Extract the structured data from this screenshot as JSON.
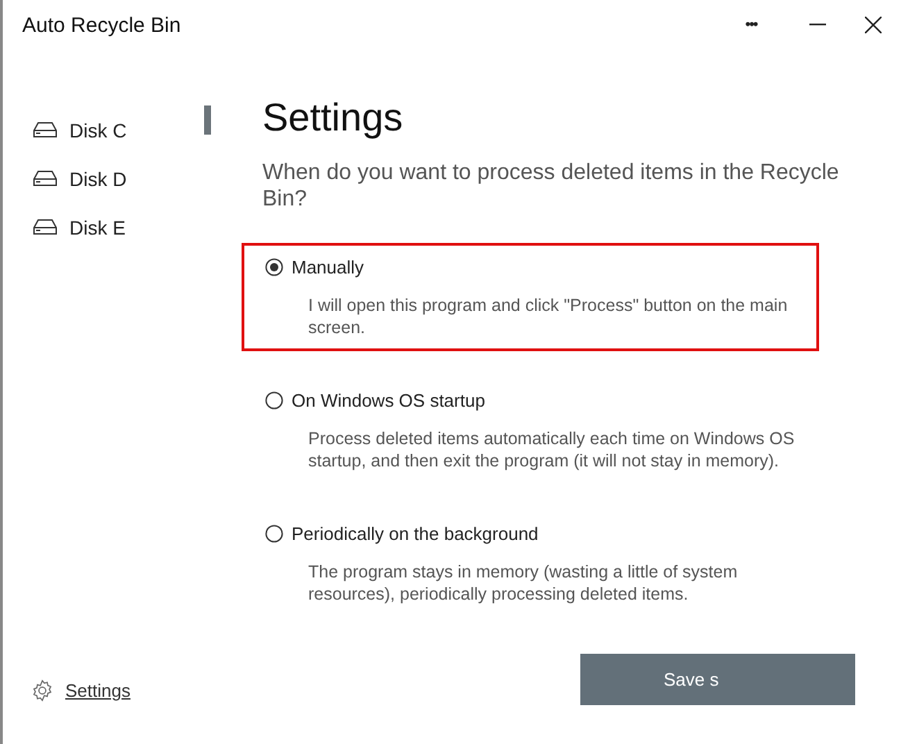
{
  "window": {
    "title": "Auto Recycle Bin",
    "menu_glyph": "•••"
  },
  "sidebar": {
    "items": [
      {
        "label": "Disk C",
        "selected": false
      },
      {
        "label": "Disk D",
        "selected": false
      },
      {
        "label": "Disk E",
        "selected": false
      }
    ],
    "footer_link": "Settings"
  },
  "content": {
    "title": "Settings",
    "question": "When do you want to process deleted items in the Recycle Bin?",
    "options": [
      {
        "label": "Manually",
        "description": "I will open this program and click \"Process\" button on the main screen.",
        "selected": true,
        "highlighted": true
      },
      {
        "label": "On Windows OS startup",
        "description": "Process deleted items automatically each time on Windows OS startup, and then exit the program (it will not stay in memory).",
        "selected": false,
        "highlighted": false
      },
      {
        "label": "Periodically on the background",
        "description": "The program stays in memory (wasting a little of system resources), periodically processing deleted items.",
        "selected": false,
        "highlighted": false
      }
    ],
    "save_button": "Save s"
  }
}
